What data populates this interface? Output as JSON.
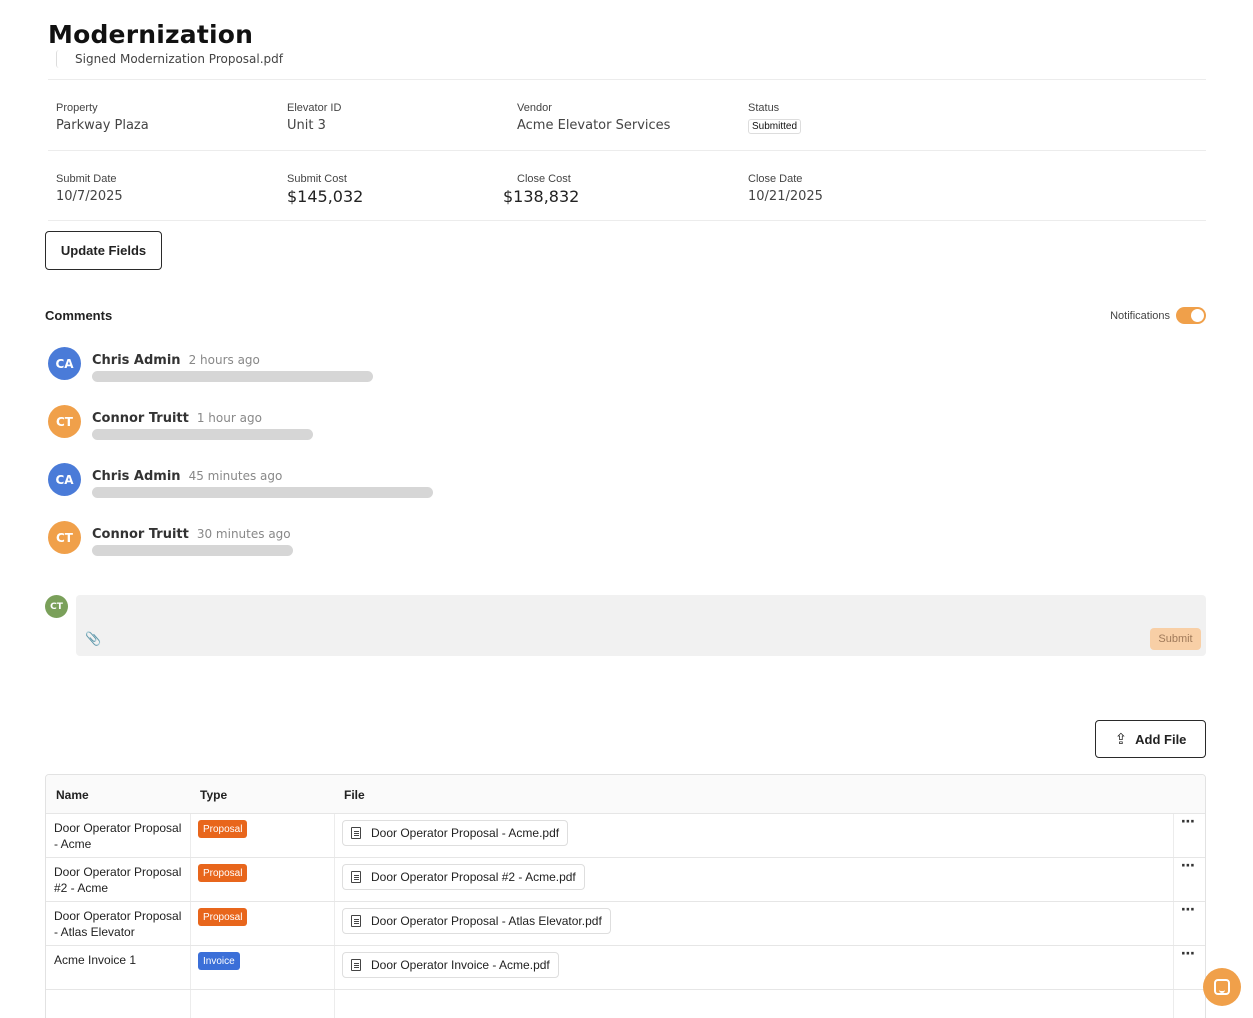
{
  "page": {
    "title": "Modernization",
    "attached_file": "Signed Modernization Proposal.pdf"
  },
  "details": {
    "row1": [
      {
        "label": "Property",
        "value": "Parkway Plaza"
      },
      {
        "label": "Elevator ID",
        "value": "Unit 3"
      },
      {
        "label": "Vendor",
        "value": "Acme Elevator Services"
      },
      {
        "label": "Status",
        "value": "Submitted"
      }
    ],
    "row2": [
      {
        "label": "Submit Date",
        "value": "10/7/2025"
      },
      {
        "label": "Submit Cost",
        "value": "$145,032"
      },
      {
        "label": "Close Cost",
        "value": "$138,832"
      },
      {
        "label": "Close Date",
        "value": "10/21/2025"
      }
    ]
  },
  "update_button": "Update Fields",
  "comments": {
    "heading": "Comments",
    "notifications_label": "Notifications",
    "notifications_on": true,
    "items": [
      {
        "initials": "CA",
        "name": "Chris Admin",
        "time": "2 hours ago",
        "avatar_color": "#4a7bd8"
      },
      {
        "initials": "CT",
        "name": "Connor Truitt",
        "time": "1 hour ago",
        "avatar_color": "#f0a04a"
      },
      {
        "initials": "CA",
        "name": "Chris Admin",
        "time": "45 minutes ago",
        "avatar_color": "#4a7bd8"
      },
      {
        "initials": "CT",
        "name": "Connor Truitt",
        "time": "30 minutes ago",
        "avatar_color": "#f0a04a"
      }
    ],
    "composer": {
      "initials": "CT",
      "submit_label": "Submit"
    }
  },
  "files": {
    "add_button": "Add File",
    "columns": [
      "Name",
      "Type",
      "File"
    ],
    "rows": [
      {
        "name": "Door Operator Proposal - Acme",
        "type": "Proposal",
        "file": "Door Operator Proposal - Acme.pdf"
      },
      {
        "name": "Door Operator Proposal #2 - Acme",
        "type": "Proposal",
        "file": "Door Operator Proposal #2 - Acme.pdf"
      },
      {
        "name": "Door Operator Proposal - Atlas Elevator",
        "type": "Proposal",
        "file": "Door Operator Proposal - Atlas Elevator.pdf"
      },
      {
        "name": "Acme Invoice 1",
        "type": "Invoice",
        "file": "Door Operator Invoice - Acme.pdf"
      }
    ]
  },
  "colors": {
    "accent": "#f0a04a",
    "proposal_badge": "#e8661c",
    "invoice_badge": "#3b6fd8"
  }
}
